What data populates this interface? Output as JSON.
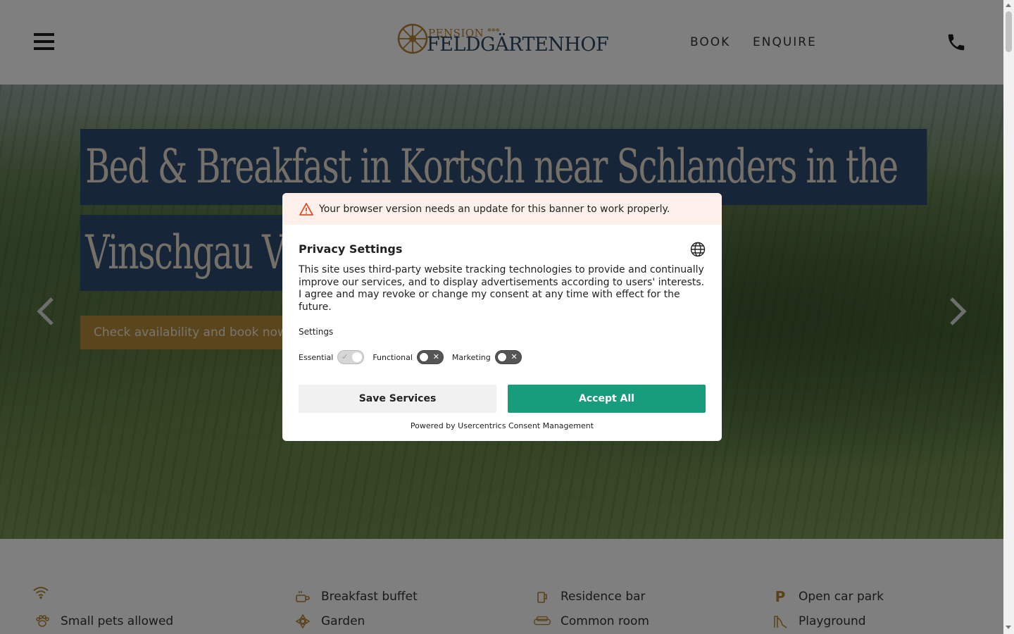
{
  "header": {
    "logo_small": "PENSION",
    "logo_big": "FELDGÄRTENHOF",
    "logo_stamp": "✻✻✻",
    "nav_book": "BOOK",
    "nav_enquire": "ENQUIRE"
  },
  "hero": {
    "title_line1": "Bed & Breakfast in Kortsch near Schlanders in the",
    "title_line2": "Vinschgau V",
    "cta": "Check availability and book now"
  },
  "amenities": [
    {
      "icon": "wifi-icon",
      "label": ""
    },
    {
      "icon": "coffee-icon",
      "label": "Breakfast buffet"
    },
    {
      "icon": "beer-glass-icon",
      "label": "Residence bar"
    },
    {
      "icon": "parking-icon",
      "label": "Open car park"
    },
    {
      "icon": "paw-icon",
      "label": "Small pets allowed"
    },
    {
      "icon": "flower-icon",
      "label": "Garden"
    },
    {
      "icon": "sofa-icon",
      "label": "Common room"
    },
    {
      "icon": "slide-icon",
      "label": "Playground"
    }
  ],
  "consent": {
    "warning": "Your browser version needs an update for this banner to work properly.",
    "title": "Privacy Settings",
    "body": "This site uses third-party website tracking technologies to provide and continually improve our services, and to display advertisements according to users' interests. I agree and may revoke or change my consent at any time with effect for the future.",
    "settings_label": "Settings",
    "toggles": [
      {
        "label": "Essential",
        "state": "on-disabled"
      },
      {
        "label": "Functional",
        "state": "off"
      },
      {
        "label": "Marketing",
        "state": "off"
      }
    ],
    "save_label": "Save Services",
    "accept_label": "Accept All",
    "powered_by": "Powered by Usercentrics Consent Management"
  },
  "colors": {
    "accent_gold": "#b5822f",
    "title_blue": "#2f4a72",
    "accept_green": "#179c7c",
    "warning_bg": "#fdf0ea"
  }
}
